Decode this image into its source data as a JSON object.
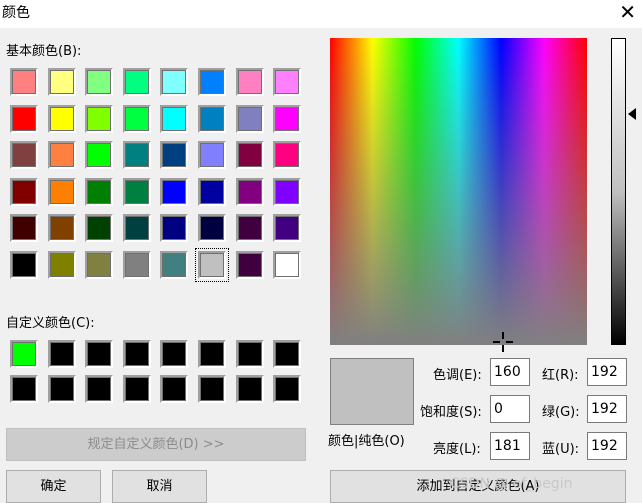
{
  "window": {
    "title": "颜色",
    "close_glyph": "✕"
  },
  "basic_label": "基本颜色(B):",
  "custom_label": "自定义颜色(C):",
  "basic_colors": [
    [
      "#ff8080",
      "#ffff80",
      "#80ff80",
      "#00ff80",
      "#80ffff",
      "#0080ff",
      "#ff80c0",
      "#ff80ff"
    ],
    [
      "#ff0000",
      "#ffff00",
      "#80ff00",
      "#00ff40",
      "#00ffff",
      "#0080c0",
      "#8080c0",
      "#ff00ff"
    ],
    [
      "#804040",
      "#ff8040",
      "#00ff00",
      "#008080",
      "#004080",
      "#8080ff",
      "#800040",
      "#ff0080"
    ],
    [
      "#800000",
      "#ff8000",
      "#008000",
      "#008040",
      "#0000ff",
      "#0000a0",
      "#800080",
      "#8000ff"
    ],
    [
      "#400000",
      "#804000",
      "#004000",
      "#004040",
      "#000080",
      "#000040",
      "#400040",
      "#400080"
    ],
    [
      "#000000",
      "#808000",
      "#808040",
      "#808080",
      "#408080",
      "#c0c0c0",
      "#400040",
      "#ffffff"
    ]
  ],
  "custom_colors": [
    [
      "#00ff00",
      "#000000",
      "#000000",
      "#000000",
      "#000000",
      "#000000",
      "#000000",
      "#000000"
    ],
    [
      "#000000",
      "#000000",
      "#000000",
      "#000000",
      "#000000",
      "#000000",
      "#000000",
      "#000000"
    ]
  ],
  "buttons": {
    "define_custom": "规定自定义颜色(D) >>",
    "ok": "确定",
    "cancel": "取消",
    "add_custom": "添加到自定义颜色(A)"
  },
  "preview": {
    "color": "#c0c0c0",
    "label": "颜色|纯色(O)"
  },
  "fields": {
    "hue": {
      "label": "色调(E):",
      "value": "160"
    },
    "sat": {
      "label": "饱和度(S):",
      "value": "0"
    },
    "lum": {
      "label": "亮度(L):",
      "value": "181"
    },
    "red": {
      "label": "红(R):",
      "value": "192"
    },
    "green": {
      "label": "绿(G):",
      "value": "192"
    },
    "blue": {
      "label": "蓝(U):",
      "value": "192"
    }
  },
  "watermark": "CSDN @ of_begin"
}
